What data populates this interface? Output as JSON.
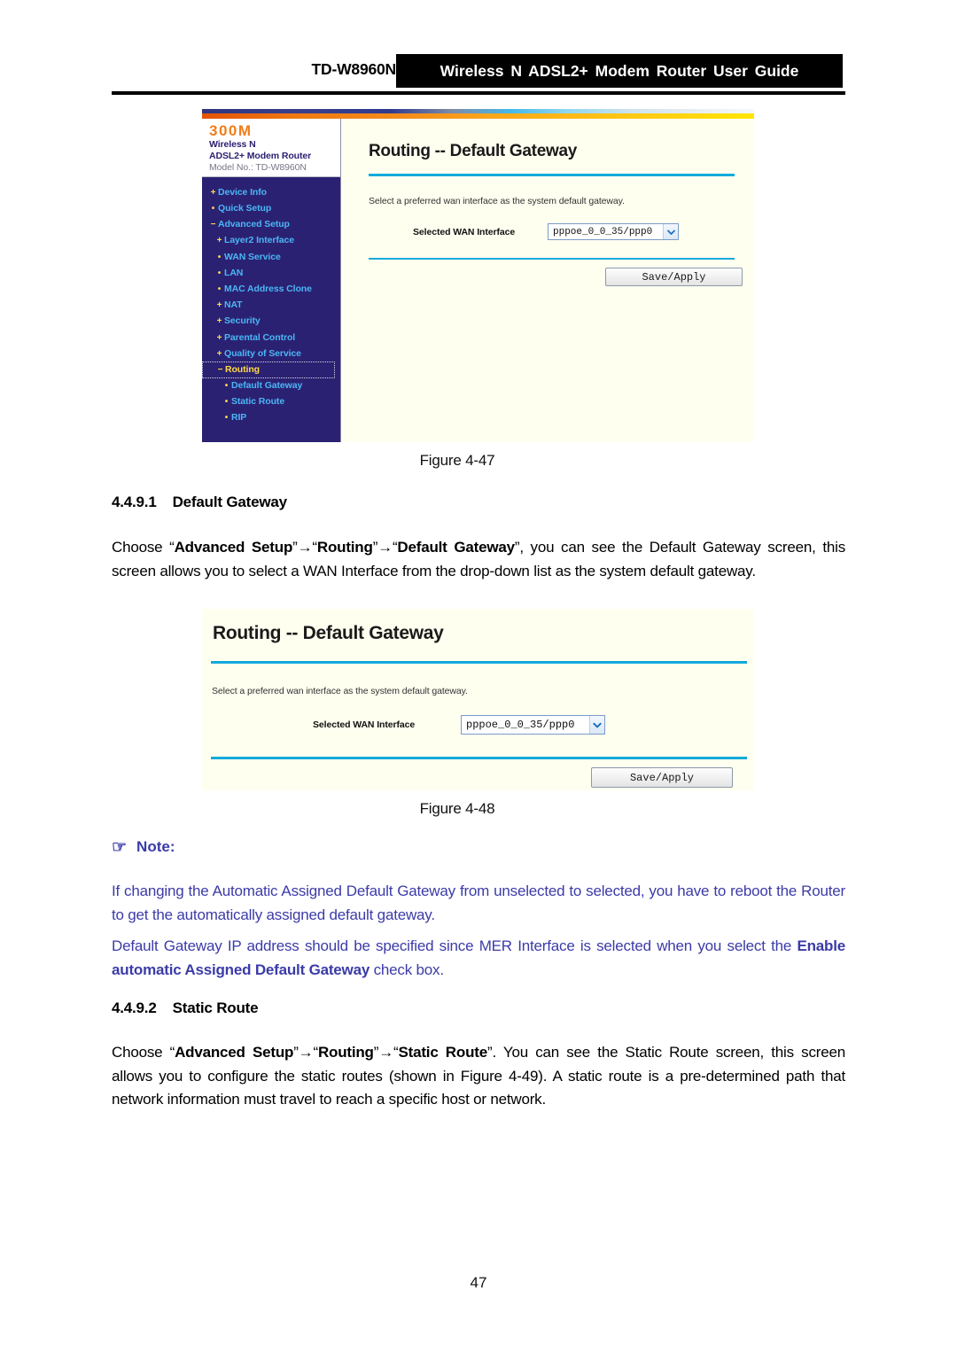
{
  "header": {
    "model": "TD-W8960N",
    "title": "Wireless N ADSL2+ Modem Router User Guide"
  },
  "router_ui": {
    "logo": {
      "speed": "300M",
      "line2": "Wireless N",
      "line3": "ADSL2+ Modem Router",
      "line4": "Model No.: TD-W8960N"
    },
    "menu": [
      {
        "marker": "+",
        "label": "Device Info",
        "level": 0,
        "selected": false
      },
      {
        "marker": "•",
        "label": "Quick Setup",
        "level": 0,
        "selected": false
      },
      {
        "marker": "−",
        "label": "Advanced Setup",
        "level": 0,
        "selected": false
      },
      {
        "marker": "+",
        "label": "Layer2 Interface",
        "level": 1,
        "selected": false
      },
      {
        "marker": "•",
        "label": "WAN Service",
        "level": 1,
        "selected": false
      },
      {
        "marker": "•",
        "label": "LAN",
        "level": 1,
        "selected": false
      },
      {
        "marker": "•",
        "label": "MAC Address Clone",
        "level": 1,
        "selected": false
      },
      {
        "marker": "+",
        "label": "NAT",
        "level": 1,
        "selected": false
      },
      {
        "marker": "+",
        "label": "Security",
        "level": 1,
        "selected": false
      },
      {
        "marker": "+",
        "label": "Parental Control",
        "level": 1,
        "selected": false
      },
      {
        "marker": "+",
        "label": "Quality of Service",
        "level": 1,
        "selected": false
      },
      {
        "marker": "−",
        "label": "Routing",
        "level": 1,
        "selected": true
      },
      {
        "marker": "•",
        "label": "Default Gateway",
        "level": 2,
        "selected": false
      },
      {
        "marker": "•",
        "label": "Static Route",
        "level": 2,
        "selected": false
      },
      {
        "marker": "•",
        "label": "RIP",
        "level": 2,
        "selected": false
      }
    ],
    "page_title": "Routing -- Default Gateway",
    "description": "Select a preferred wan interface as the system default gateway.",
    "field_label": "Selected WAN Interface",
    "select_value": "pppoe_0_0_35/ppp0",
    "save_button": "Save/Apply",
    "colors": {
      "sidebar_bg": "#2b2172",
      "content_bg": "#fffff0",
      "accent_rule": "#13aadc",
      "menu_link": "#4ab6f5",
      "menu_marker": "#ffd94a",
      "logo_orange": "#f07d1a",
      "logo_blue": "#2b2172"
    }
  },
  "captions": {
    "fig_4_47": "Figure 4-47",
    "fig_4_48": "Figure 4-48"
  },
  "sections": {
    "default_gateway": {
      "number": "4.4.9.1",
      "title": "Default Gateway",
      "body_pre": "Choose “",
      "body_b1": "Advanced Setup",
      "body_s1": "”→“",
      "body_b2": "Routing",
      "body_s2": "”→“",
      "body_b3": "Default Gateway",
      "body_post": "”, you can see the Default Gateway screen, this screen allows you to select a WAN Interface from the drop-down list as the system default gateway."
    },
    "static_route": {
      "number": "4.4.9.2",
      "title": "Static Route",
      "body_pre": "Choose “",
      "body_b1": "Advanced Setup",
      "body_s1": "”→“",
      "body_b2": "Routing",
      "body_s2": "”→“",
      "body_b3": "Static Route",
      "body_post": "”. You can see the Static Route screen, this screen allows you to configure the static routes (shown in Figure 4-49). A static route is a pre-determined path that network information must travel to reach a specific host or network."
    }
  },
  "note": {
    "icon": "☞",
    "label": "Note:",
    "paragraph_1": "If changing the Automatic Assigned Default Gateway from unselected to selected, you have to reboot the Router to get the automatically assigned default gateway.",
    "p2_pre": "Default Gateway IP address should be specified since MER Interface is selected when you select the ",
    "p2_bold": "Enable automatic Assigned Default Gateway",
    "p2_post": " check box.",
    "color": "#3b3ba8"
  },
  "page_number": "47"
}
